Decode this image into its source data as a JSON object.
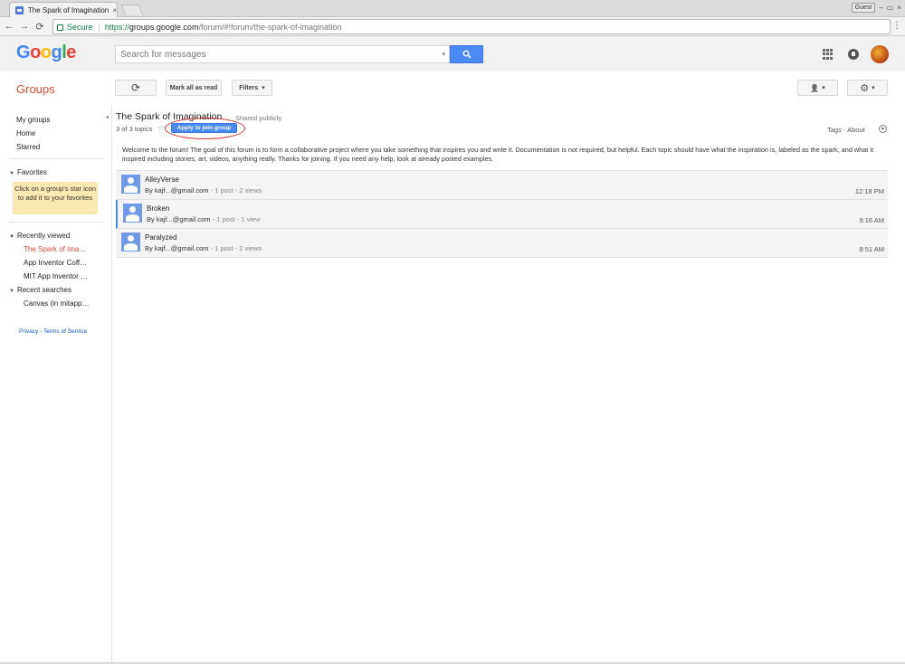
{
  "browser": {
    "tab_title": "The Spark of Imagination",
    "tab_close": "×",
    "guest_label": "Guest",
    "window_controls": [
      "–",
      "▭",
      "×"
    ],
    "secure_label": "Secure",
    "url_proto": "https://",
    "url_host": "groups.google.com",
    "url_path": "/forum/#!forum/the-spark-of-imagination"
  },
  "header": {
    "logo_letters": [
      {
        "ch": "G",
        "color": "#4285f4"
      },
      {
        "ch": "o",
        "color": "#ea4335"
      },
      {
        "ch": "o",
        "color": "#fbbc05"
      },
      {
        "ch": "g",
        "color": "#4285f4"
      },
      {
        "ch": "l",
        "color": "#34a853"
      },
      {
        "ch": "e",
        "color": "#ea4335"
      }
    ],
    "search_placeholder": "Search for messages"
  },
  "groups_bar": {
    "title": "Groups",
    "refresh_icon": "⟳",
    "mark_all_read": "Mark all as read",
    "filters": "Filters",
    "members_icon": "👤",
    "settings_icon": "⚙",
    "dropdown_caret": "▾"
  },
  "sidebar": {
    "items": [
      "My groups",
      "Home",
      "Starred"
    ],
    "favorites_heading": "Favorites",
    "favorites_hint": "Click on a group's star icon to add it to your favorites",
    "recently_viewed_heading": "Recently viewed",
    "recently_viewed": [
      "The Spark of Ima…",
      "App Inventor Coff…",
      "MIT App Inventor …"
    ],
    "recent_searches_heading": "Recent searches",
    "recent_searches": [
      "Canvas (in mitapp…"
    ],
    "footer": "Privacy - Terms of Service"
  },
  "forum": {
    "title": "The Spark of Imagination",
    "visibility": "Shared publicly",
    "topic_count": "3 of 3 topics",
    "join_button": "Apply to join group",
    "tags_about": "Tags · About",
    "welcome": "Welcome to the forum! The goal of this forum is to form a collaborative project where you take something that inspires you and write it. Documentation is not required, but helpful. Each topic should have what the inspiration is, labeled as the spark, and what it inspired including stories, art, videos, anything really. Thanks for joining. If you need any help, look at already posted examples.",
    "topics": [
      {
        "subject": "AlleyVerse",
        "author": "By kajf...@gmail.com",
        "stats": " - 1 post - 2 views",
        "time": "12:18 PM"
      },
      {
        "subject": "Broken",
        "author": "By kajf...@gmail.com",
        "stats": " - 1 post - 1 view",
        "time": "9:16 AM"
      },
      {
        "subject": "Paralyzed",
        "author": "By kajf...@gmail.com",
        "stats": " - 1 post - 2 views",
        "time": "8:51 AM"
      }
    ]
  }
}
